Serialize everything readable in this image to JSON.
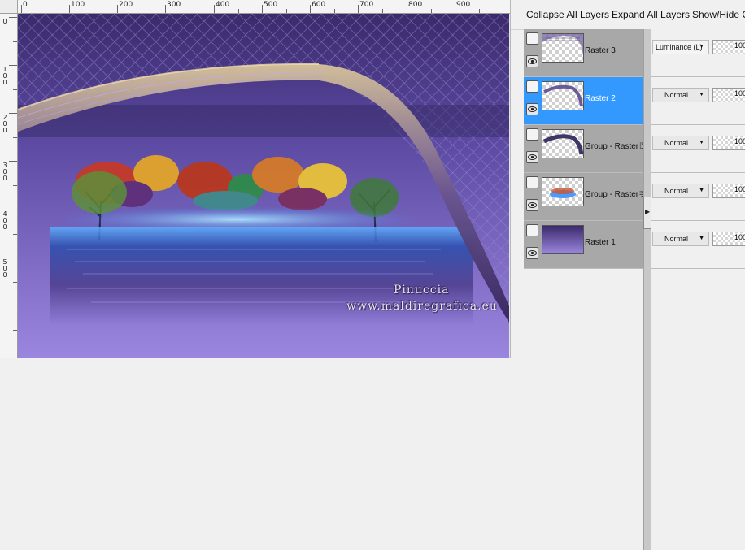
{
  "ruler": {
    "h_labels": [
      "0",
      "100",
      "200",
      "300",
      "400",
      "500",
      "600",
      "700",
      "800",
      "900"
    ],
    "v_labels": [
      "0",
      "1 0 0",
      "2 0 0",
      "3 0 0",
      "4 0 0",
      "5 0 0"
    ]
  },
  "watermark": {
    "name": "Pinuccia",
    "url": "www.maldiregrafica.eu"
  },
  "toolbar": {
    "collapse_all": "Collapse All Layers",
    "expand_all": "Expand All Layers",
    "show_hide": "Show/Hide C"
  },
  "layers": [
    {
      "name": "Raster 3",
      "blend_mode": "Luminance (L)",
      "opacity": "100",
      "selected": false,
      "thumb": "texture-overlay"
    },
    {
      "name": "Raster 2",
      "blend_mode": "Normal",
      "opacity": "100",
      "selected": true,
      "thumb": "eye-curve"
    },
    {
      "name": "Group - Raster 1",
      "blend_mode": "Normal",
      "opacity": "100",
      "selected": false,
      "thumb": "eye-curve-shaded"
    },
    {
      "name": "Group - Raster 1",
      "blend_mode": "Normal",
      "opacity": "100",
      "selected": false,
      "thumb": "landscape-tube"
    },
    {
      "name": "Raster 1",
      "blend_mode": "Normal",
      "opacity": "100",
      "selected": false,
      "thumb": "purple-gradient"
    }
  ],
  "colors": {
    "selected_row": "#3399ff",
    "row_bg": "#a8a8a8",
    "canvas_purple_top": "#3b2a6b",
    "canvas_purple_bottom": "#9b86df"
  }
}
